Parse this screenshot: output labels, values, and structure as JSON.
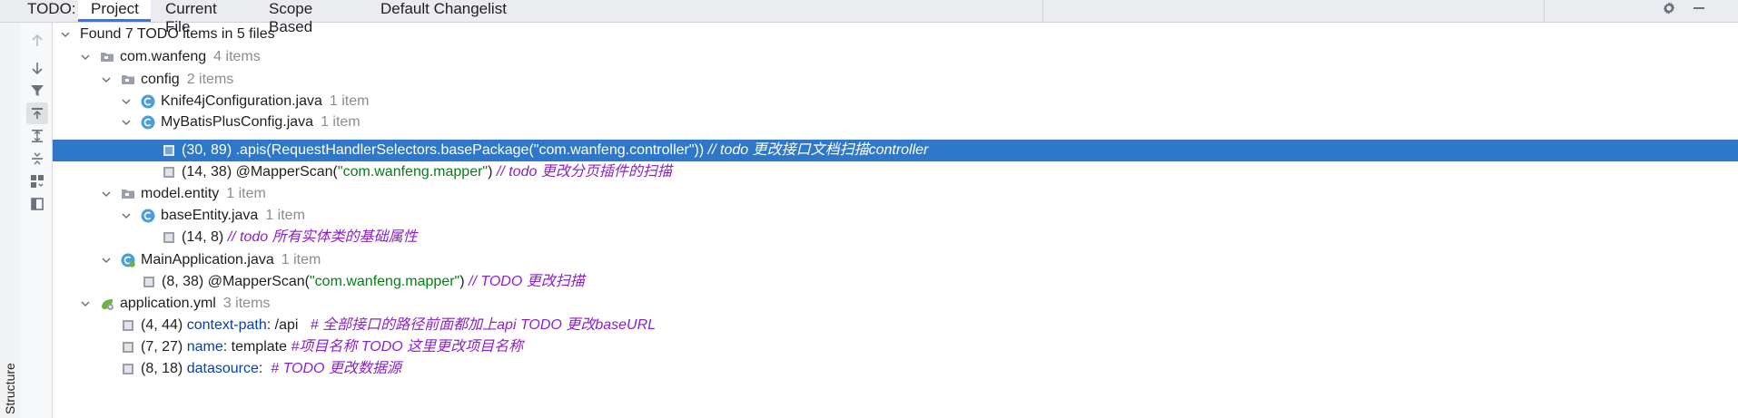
{
  "header": {
    "todo_label": "TODO:",
    "tabs": [
      {
        "label": "Project",
        "active": true
      },
      {
        "label": "Current File",
        "active": false
      },
      {
        "label": "Scope Based",
        "active": false
      },
      {
        "label": "Default Changelist",
        "active": false
      }
    ],
    "actions": {
      "settings_icon": "gear-icon",
      "minimize_icon": "minimize-icon"
    }
  },
  "sidebar": {
    "structure_label": "Structure"
  },
  "toolbar": {
    "buttons": [
      {
        "icon": "arrow-up-icon",
        "enabled": false
      },
      {
        "icon": "arrow-down-icon",
        "enabled": true
      },
      {
        "icon": "filter-icon",
        "enabled": true
      },
      {
        "icon": "autoscroll-icon",
        "enabled": true,
        "pressed": true
      },
      {
        "icon": "expand-all-icon",
        "enabled": true
      },
      {
        "icon": "collapse-all-icon",
        "enabled": true
      },
      {
        "icon": "group-by-icon",
        "enabled": true
      },
      {
        "icon": "preview-pane-icon",
        "enabled": true
      }
    ]
  },
  "tree": {
    "summary": "Found 7 TODO items in 5 files",
    "nodes": [
      {
        "name": "com.wanfeng",
        "count": "4 items"
      },
      {
        "name": "config",
        "count": "2 items"
      },
      {
        "name": "Knife4jConfiguration.java",
        "count": "1 item"
      },
      {
        "pos": "(30, 89)",
        "code": ".apis(RequestHandlerSelectors.basePackage(\"com.wanfeng.controller\"))",
        "comment": "// todo 更改接口文档扫描controller"
      },
      {
        "name": "MyBatisPlusConfig.java",
        "count": "1 item"
      },
      {
        "pos": "(14, 38)",
        "code": "@MapperScan(",
        "str": "\"com.wanfeng.mapper\"",
        "code_end": ")",
        "comment": "// todo  更改分页插件的扫描"
      },
      {
        "name": "model.entity",
        "count": "1 item"
      },
      {
        "name": "baseEntity.java",
        "count": "1 item"
      },
      {
        "pos": "(14, 8)",
        "comment": "// todo 所有实体类的基础属性"
      },
      {
        "name": "MainApplication.java",
        "count": "1 item"
      },
      {
        "pos": "(8, 38)",
        "code": "@MapperScan(",
        "str": "\"com.wanfeng.mapper\"",
        "code_end": ")",
        "comment": "// TODO 更改扫描"
      },
      {
        "name": "application.yml",
        "count": "3 items"
      },
      {
        "pos": "(4, 44)",
        "key": "context-path",
        "value": ": /api",
        "comment": "# 全部接口的路径前面都加上api TODO 更改baseURL"
      },
      {
        "pos": "(7, 27)",
        "key": "name",
        "value": ": template",
        "comment": "#项目名称 TODO 这里更改项目名称"
      },
      {
        "pos": "(8, 18)",
        "key": "datasource",
        "value": ":",
        "comment": "# TODO 更改数据源"
      }
    ]
  },
  "colors": {
    "selection": "#2f78c9",
    "accent": "#3574f0",
    "string": "#067d17",
    "comment": "#8c21c9",
    "yaml_key": "#0a3fa3",
    "count": "#8c8c8c",
    "java_class_icon": "#4a9fd8"
  }
}
